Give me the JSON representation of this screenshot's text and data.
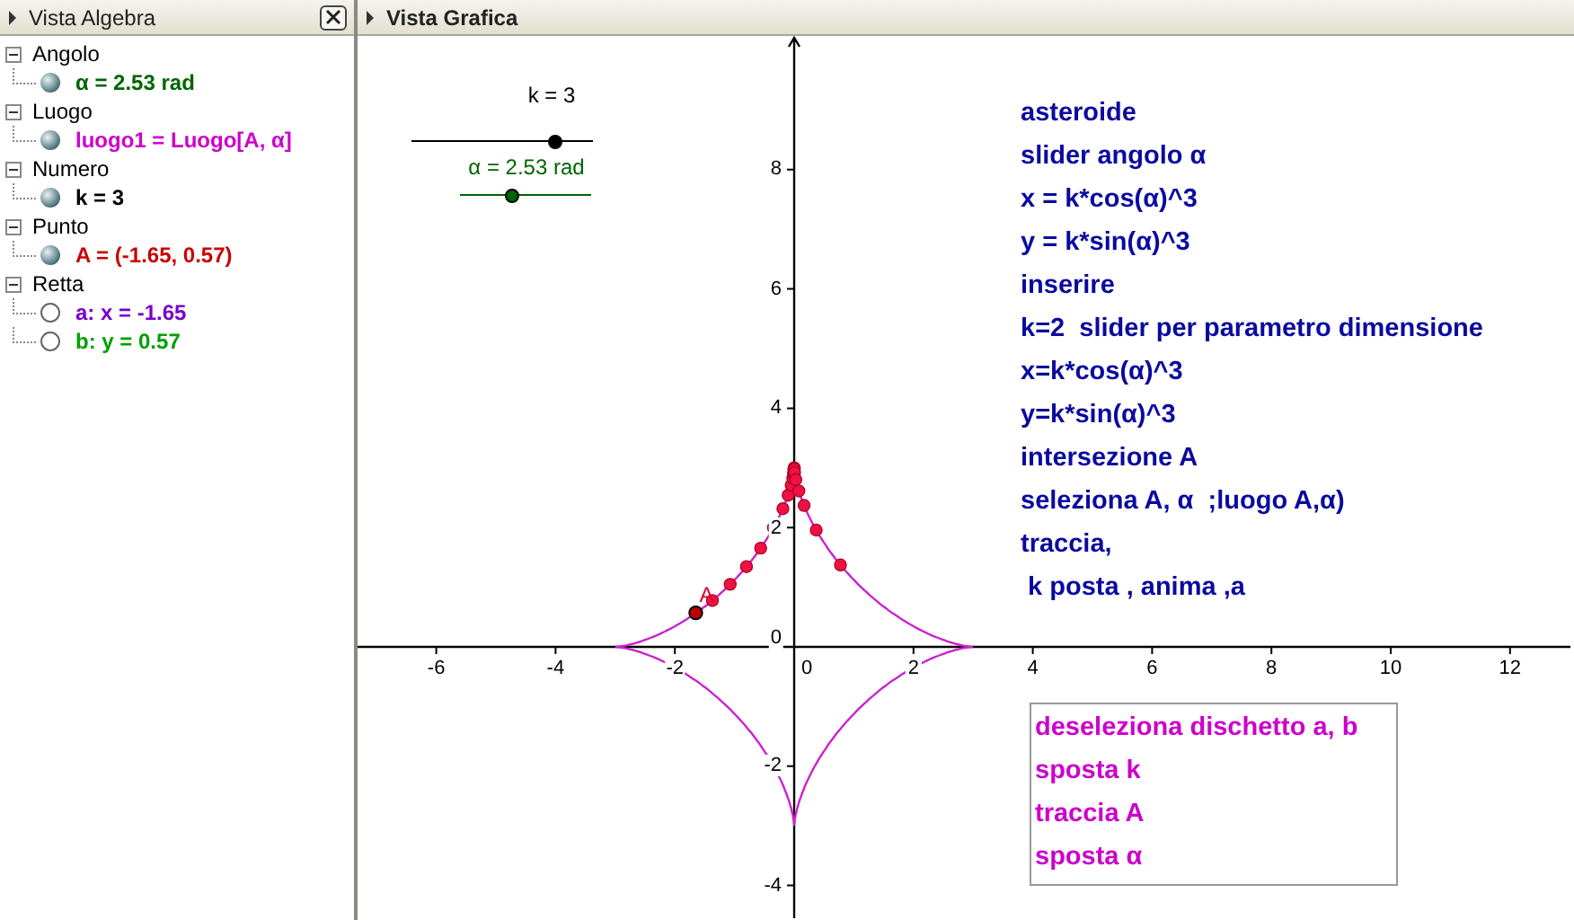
{
  "algebra_view": {
    "title": "Vista Algebra",
    "groups": [
      {
        "label": "Angolo",
        "expanded": true,
        "children": [
          {
            "text": "α = 2.53 rad",
            "color": "#006400",
            "visible": true
          }
        ]
      },
      {
        "label": "Luogo",
        "expanded": true,
        "children": [
          {
            "text": "luogo1 = Luogo[A, α]",
            "color": "#cc00cc",
            "visible": true
          }
        ]
      },
      {
        "label": "Numero",
        "expanded": true,
        "children": [
          {
            "text": "k = 3",
            "color": "#000000",
            "visible": true
          }
        ]
      },
      {
        "label": "Punto",
        "expanded": true,
        "children": [
          {
            "text": "A = (-1.65, 0.57)",
            "color": "#cc0000",
            "visible": true
          }
        ]
      },
      {
        "label": "Retta",
        "expanded": true,
        "children": [
          {
            "text": "a: x = -1.65",
            "color": "#7a00cc",
            "visible": false
          },
          {
            "text": "b: y = 0.57",
            "color": "#00a000",
            "visible": false
          }
        ]
      }
    ]
  },
  "graphics_view": {
    "title": "Vista Grafica",
    "sliders": [
      {
        "label": "k = 3",
        "color": "#000000",
        "level": 0.79
      },
      {
        "label": "α = 2.53 rad",
        "color": "#006400",
        "level": 0.4
      }
    ],
    "x_ticks": [
      "-6",
      "-4",
      "-2",
      "0",
      "2",
      "4",
      "6",
      "8",
      "10",
      "12"
    ],
    "y_ticks": [
      "8",
      "6",
      "4",
      "2",
      "0",
      "-2",
      "-4"
    ],
    "point_label": "A",
    "notes": [
      "asteroide",
      "slider angolo α",
      "x = k*cos(α)^3",
      "y = k*sin(α)^3",
      "inserire",
      "k=2  slider per parametro dimensione",
      "x=k*cos(α)^3",
      "y=k*sin(α)^3",
      "intersezione A",
      "seleziona A, α  ;luogo A,α)",
      "traccia,",
      " k posta , anima ,a"
    ],
    "steps": [
      "deseleziona dischetto a, b",
      "sposta k",
      "traccia A",
      "sposta α"
    ]
  }
}
